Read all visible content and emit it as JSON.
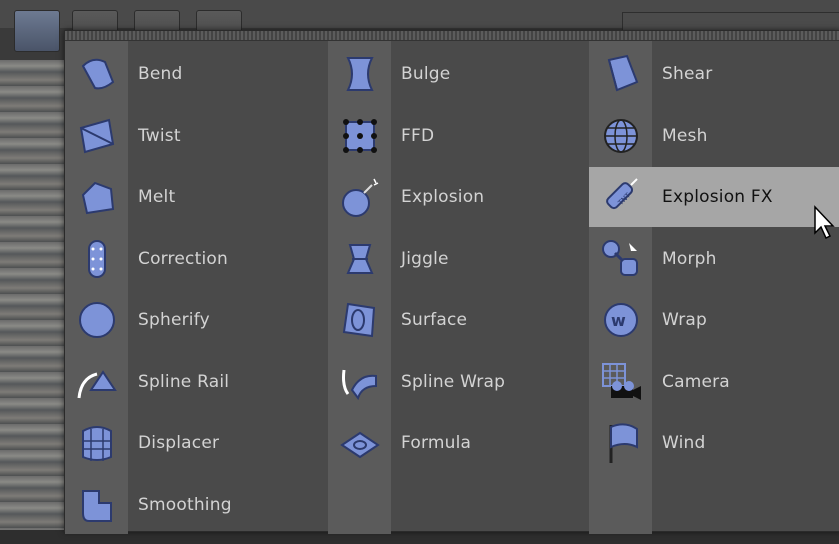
{
  "columns": [
    [
      {
        "label": "Bend",
        "icon": "bend-icon"
      },
      {
        "label": "Twist",
        "icon": "twist-icon"
      },
      {
        "label": "Melt",
        "icon": "melt-icon"
      },
      {
        "label": "Correction",
        "icon": "correction-icon"
      },
      {
        "label": "Spherify",
        "icon": "spherify-icon"
      },
      {
        "label": "Spline Rail",
        "icon": "spline-rail-icon"
      },
      {
        "label": "Displacer",
        "icon": "displacer-icon"
      },
      {
        "label": "Smoothing",
        "icon": "smoothing-icon"
      }
    ],
    [
      {
        "label": "Bulge",
        "icon": "bulge-icon"
      },
      {
        "label": "FFD",
        "icon": "ffd-icon"
      },
      {
        "label": "Explosion",
        "icon": "explosion-icon"
      },
      {
        "label": "Jiggle",
        "icon": "jiggle-icon"
      },
      {
        "label": "Surface",
        "icon": "surface-icon"
      },
      {
        "label": "Spline Wrap",
        "icon": "spline-wrap-icon"
      },
      {
        "label": "Formula",
        "icon": "formula-icon"
      }
    ],
    [
      {
        "label": "Shear",
        "icon": "shear-icon"
      },
      {
        "label": "Mesh",
        "icon": "mesh-icon"
      },
      {
        "label": "Explosion FX",
        "icon": "explosion-fx-icon",
        "selected": true
      },
      {
        "label": "Morph",
        "icon": "morph-icon"
      },
      {
        "label": "Wrap",
        "icon": "wrap-icon"
      },
      {
        "label": "Camera",
        "icon": "camera-icon"
      },
      {
        "label": "Wind",
        "icon": "wind-icon"
      }
    ]
  ],
  "colors": {
    "icon_fill": "#7d93d8",
    "icon_stroke": "#2c3a6e",
    "highlight": "#a6a6a6"
  }
}
